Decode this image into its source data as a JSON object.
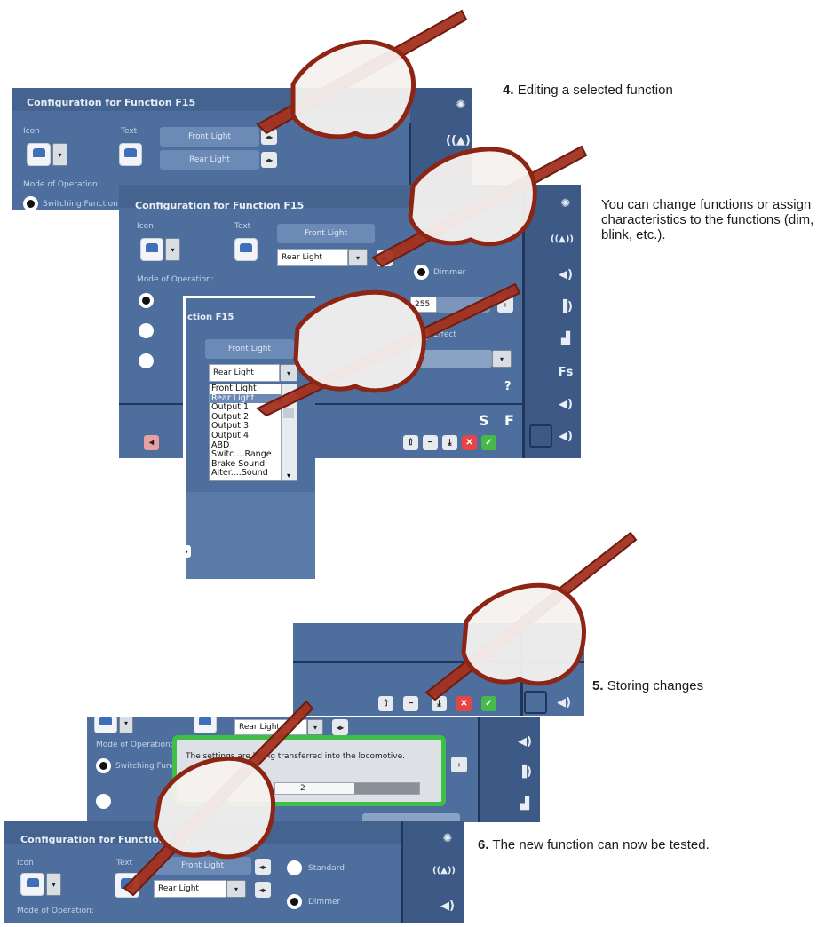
{
  "captions": {
    "step4_num": "4.",
    "step4_text": "Editing a selected function",
    "desc_text": "You can change functions or assign characteristics to the functions (dim, blink, etc.).",
    "step5_num": "5.",
    "step5_text": "Storing changes",
    "step6_num": "6.",
    "step6_text": "The new function can now be tested."
  },
  "config": {
    "title": "Configuration for Function F15",
    "icon_label": "Icon",
    "text_label": "Text",
    "mode_label": "Mode of Operation:",
    "front_light": "Front Light",
    "rear_light": "Rear Light",
    "switching_function": "Switching Function",
    "dimmer": "Dimmer",
    "effect": "Effect",
    "standard": "Standard",
    "dim_value": "255",
    "help": "?"
  },
  "dropdown": {
    "header": "ction F15",
    "title_field": "Front Light",
    "selected": "Rear Light",
    "options": [
      "Front Light",
      "Rear Light",
      "Output 1",
      "Output 2",
      "Output 3",
      "Output 4",
      "ABD",
      "Switc....Range",
      "Brake Sound",
      "Alter....Sound"
    ]
  },
  "panel_letters": {
    "s": "S",
    "f": "F",
    "fs": "Fs"
  },
  "transfer": {
    "message": "The settings are being transferred into the locomotive.",
    "progress_text": "2",
    "progress_fraction": 0.55
  },
  "icons": {
    "side": [
      "light-icon",
      "wireless-icon",
      "sound-icon",
      "horn-icon",
      "coupler-icon",
      "fs-icon",
      "sound-icon"
    ],
    "toolbar": [
      "up-arrow-icon",
      "minus-icon",
      "save-icon",
      "cancel-icon",
      "confirm-icon"
    ]
  },
  "colors": {
    "panel": "#4e6f9e",
    "pen": "#9e2a1c",
    "confirm": "#47b94a",
    "cancel": "#e64545",
    "dialog_border": "#3fbf45"
  }
}
